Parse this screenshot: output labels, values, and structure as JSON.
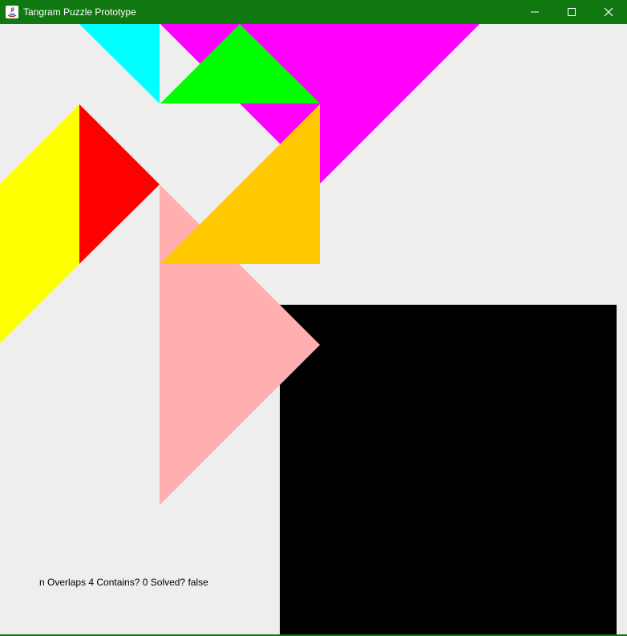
{
  "window": {
    "title": "Tangram Puzzle Prototype",
    "titlebar_color": "#117711",
    "app_icon": "java-app-icon",
    "controls": {
      "minimize_icon": "minimize-icon",
      "maximize_icon": "maximize-icon",
      "close_icon": "close-icon"
    }
  },
  "canvas": {
    "background": "#eeeeee",
    "target_shape_color": "#000000",
    "pieces": [
      {
        "name": "cyan-small-triangle",
        "color": "#00ffff"
      },
      {
        "name": "magenta-large-triangle",
        "color": "#ff00ff"
      },
      {
        "name": "green-small-triangle",
        "color": "#00ff00"
      },
      {
        "name": "yellow-parallelogram",
        "color": "#ffff00"
      },
      {
        "name": "red-triangle",
        "color": "#ff0000"
      },
      {
        "name": "orange-medium-triangle",
        "color": "#ffc800"
      },
      {
        "name": "pink-large-triangle",
        "color": "#ffafaf"
      }
    ]
  },
  "status": {
    "text": "n Overlaps 4 Contains? 0 Solved? false"
  }
}
